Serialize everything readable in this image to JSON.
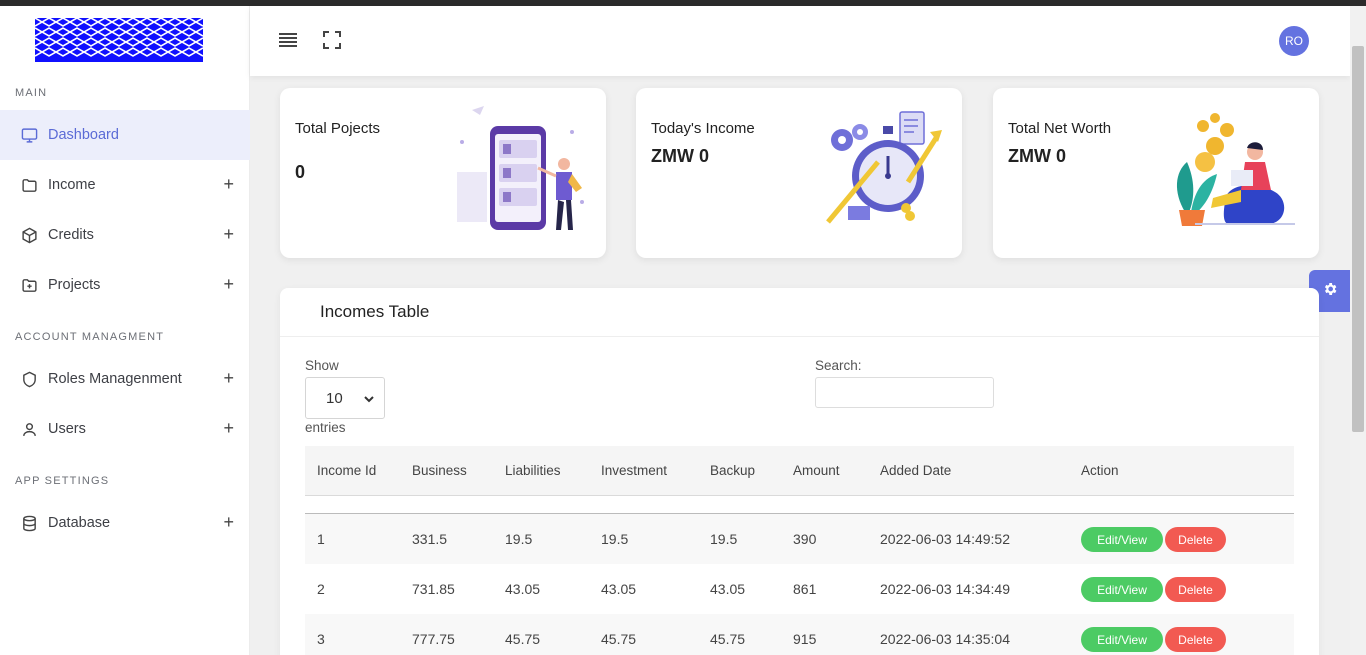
{
  "sidebar": {
    "sections": {
      "main": "MAIN",
      "account": "ACCOUNT MANAGMENT",
      "app": "APP SETTINGS"
    },
    "items": [
      {
        "label": "Dashboard",
        "icon": "monitor-icon"
      },
      {
        "label": "Income",
        "icon": "folder-icon"
      },
      {
        "label": "Credits",
        "icon": "box-icon"
      },
      {
        "label": "Projects",
        "icon": "folder-plus-icon"
      },
      {
        "label": "Roles Managenment",
        "icon": "shield-icon"
      },
      {
        "label": "Users",
        "icon": "user-icon"
      },
      {
        "label": "Database",
        "icon": "database-icon"
      }
    ],
    "plus": "+"
  },
  "header": {
    "avatar_initials": "RO"
  },
  "cards": [
    {
      "title": "Total Pojects",
      "value": "0"
    },
    {
      "title": "Today's Income",
      "value": "ZMW 0"
    },
    {
      "title": "Total Net Worth",
      "value": "ZMW 0"
    }
  ],
  "table": {
    "title": "Incomes Table",
    "show_label": "Show",
    "page_size": "10",
    "entries_label": "entries",
    "search_label": "Search:",
    "columns": [
      "Income Id",
      "Business",
      "Liabilities",
      "Investment",
      "Backup",
      "Amount",
      "Added Date",
      "Action"
    ],
    "rows": [
      [
        "1",
        "331.5",
        "19.5",
        "19.5",
        "19.5",
        "390",
        "2022-06-03 14:49:52"
      ],
      [
        "2",
        "731.85",
        "43.05",
        "43.05",
        "43.05",
        "861",
        "2022-06-03 14:34:49"
      ],
      [
        "3",
        "777.75",
        "45.75",
        "45.75",
        "45.75",
        "915",
        "2022-06-03 14:35:04"
      ]
    ],
    "edit_label": "Edit/View",
    "delete_label": "Delete"
  },
  "colors": {
    "accent": "#6472e0",
    "edit": "#4ccb64",
    "delete": "#f25a52"
  }
}
